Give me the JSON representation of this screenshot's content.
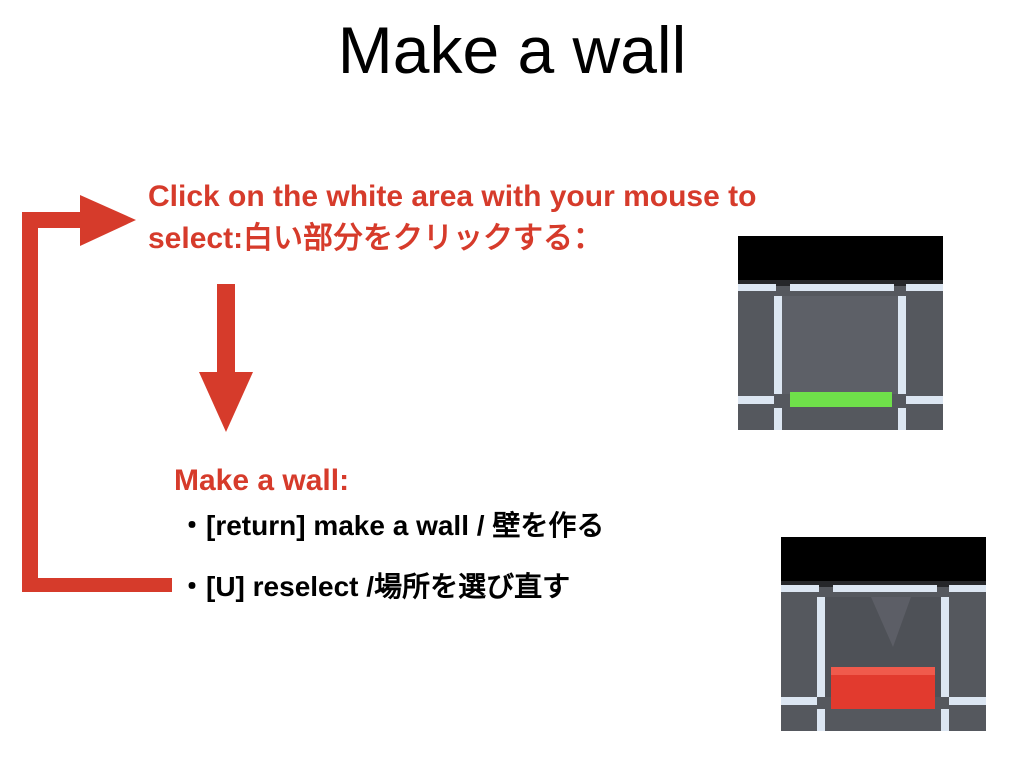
{
  "slide": {
    "title": "Make a wall",
    "instruction_line1": "Click on the white area with your mouse to",
    "instruction_line2": "select:白い部分をクリックする：",
    "section_heading": "Make a wall:",
    "bullets": [
      "・[return] make a wall / 壁を作る",
      "・[U] reselect /場所を選び直す"
    ]
  },
  "colors": {
    "accent_red": "#d63b2b",
    "selection_green": "#6fe04a",
    "wall_red": "#e23a2e",
    "tile_gray": "#5a5d63",
    "grid_line": "#dce6f2"
  },
  "images": {
    "before": {
      "icon": "grid-selected-cell-green-marker"
    },
    "after": {
      "icon": "grid-cell-red-wall-placed"
    }
  }
}
